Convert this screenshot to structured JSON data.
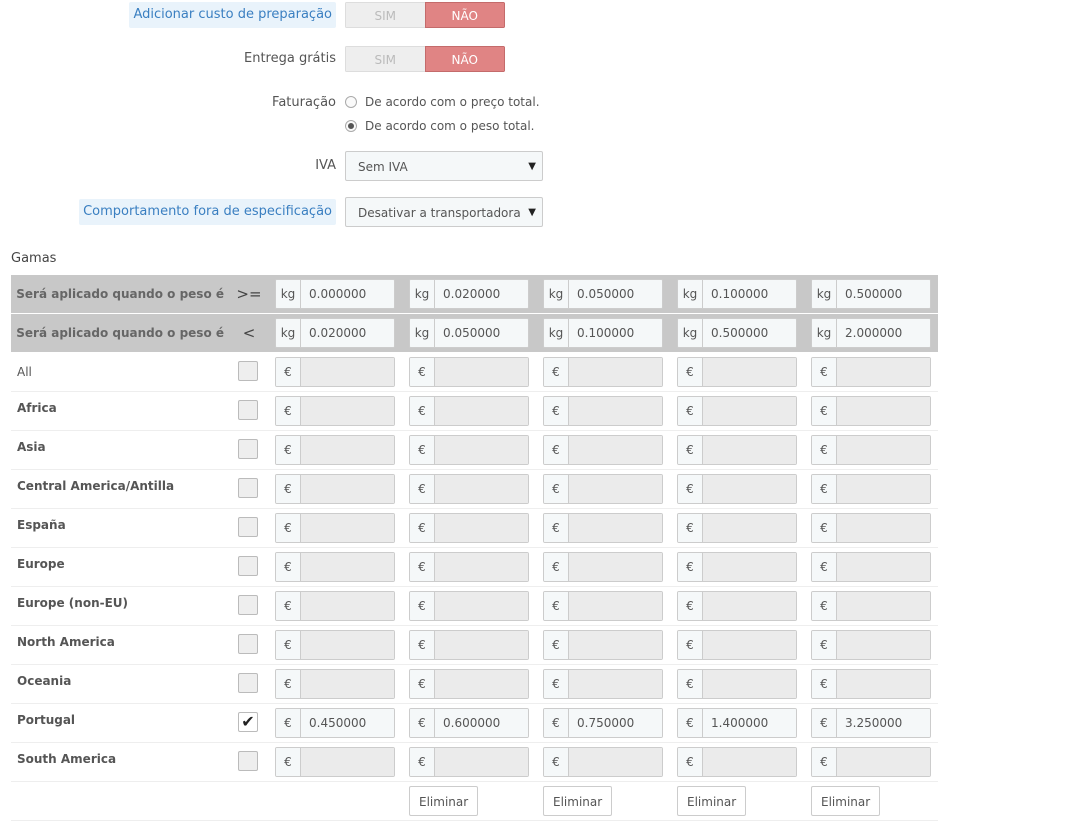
{
  "settings": {
    "handling_cost": {
      "label": "Adicionar custo de preparação",
      "yes": "SIM",
      "no": "NÃO"
    },
    "free_shipping": {
      "label": "Entrega grátis",
      "yes": "SIM",
      "no": "NÃO"
    },
    "billing": {
      "label": "Faturação",
      "option_price": "De acordo com o preço total.",
      "option_weight": "De acordo com o peso total.",
      "selected": "De acordo com o peso total."
    },
    "tax": {
      "label": "IVA",
      "value": "Sem IVA"
    },
    "out_of_range": {
      "label": "Comportamento fora de especificação",
      "value": "Desativar a transportadora"
    }
  },
  "ranges": {
    "title": "Gamas",
    "from_label": "Será aplicado quando o peso é",
    "from_op": ">=",
    "to_label": "Será aplicado quando o peso é",
    "to_op": "<",
    "unit": "kg",
    "from": [
      "0.000000",
      "0.020000",
      "0.050000",
      "0.100000",
      "0.500000"
    ],
    "to": [
      "0.020000",
      "0.050000",
      "0.100000",
      "0.500000",
      "2.000000"
    ],
    "currency": "€",
    "zones": [
      {
        "name": "All",
        "checked": false,
        "prices": [
          "",
          "",
          "",
          "",
          ""
        ]
      },
      {
        "name": "Africa",
        "checked": false,
        "prices": [
          "",
          "",
          "",
          "",
          ""
        ]
      },
      {
        "name": "Asia",
        "checked": false,
        "prices": [
          "",
          "",
          "",
          "",
          ""
        ]
      },
      {
        "name": "Central America/Antilla",
        "checked": false,
        "prices": [
          "",
          "",
          "",
          "",
          ""
        ]
      },
      {
        "name": "España",
        "checked": false,
        "prices": [
          "",
          "",
          "",
          "",
          ""
        ]
      },
      {
        "name": "Europe",
        "checked": false,
        "prices": [
          "",
          "",
          "",
          "",
          ""
        ]
      },
      {
        "name": "Europe (non-EU)",
        "checked": false,
        "prices": [
          "",
          "",
          "",
          "",
          ""
        ]
      },
      {
        "name": "North America",
        "checked": false,
        "prices": [
          "",
          "",
          "",
          "",
          ""
        ]
      },
      {
        "name": "Oceania",
        "checked": false,
        "prices": [
          "",
          "",
          "",
          "",
          ""
        ]
      },
      {
        "name": "Portugal",
        "checked": true,
        "prices": [
          "0.450000",
          "0.600000",
          "0.750000",
          "1.400000",
          "3.250000"
        ]
      },
      {
        "name": "South America",
        "checked": false,
        "prices": [
          "",
          "",
          "",
          "",
          ""
        ]
      }
    ],
    "delete_label": "Eliminar"
  }
}
